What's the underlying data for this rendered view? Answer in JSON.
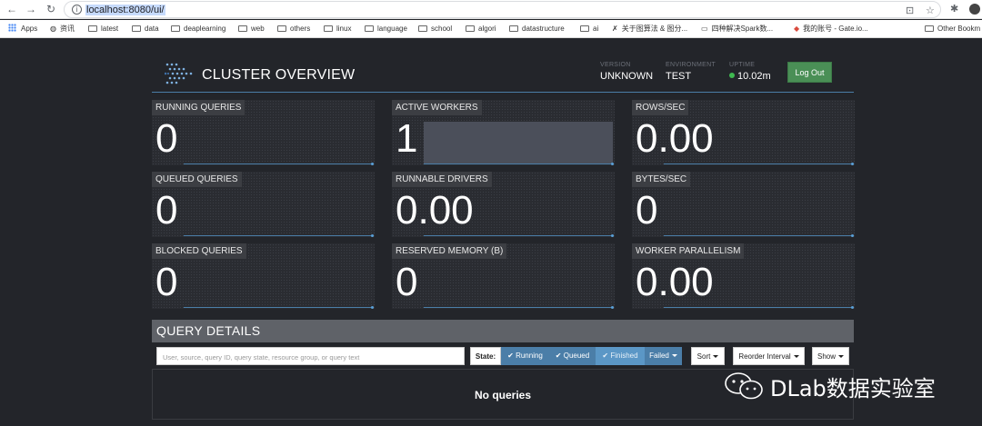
{
  "browser": {
    "url": "localhost:8080/ui/",
    "bookmarks": [
      {
        "label": "Apps",
        "type": "apps"
      },
      {
        "label": "资讯",
        "type": "globe"
      },
      {
        "label": "latest",
        "type": "folder"
      },
      {
        "label": "data",
        "type": "folder"
      },
      {
        "label": "deaplearning",
        "type": "folder"
      },
      {
        "label": "web",
        "type": "folder"
      },
      {
        "label": "others",
        "type": "folder"
      },
      {
        "label": "linux",
        "type": "folder"
      },
      {
        "label": "language",
        "type": "folder"
      },
      {
        "label": "school",
        "type": "folder"
      },
      {
        "label": "algori",
        "type": "folder"
      },
      {
        "label": "datastructure",
        "type": "folder"
      },
      {
        "label": "ai",
        "type": "folder"
      },
      {
        "label": "关于图算法 & 图分...",
        "type": "page"
      },
      {
        "label": "四种解决Spark数...",
        "type": "page"
      },
      {
        "label": "我的账号 - Gate.io...",
        "type": "page"
      },
      {
        "label": "Other Bookm",
        "type": "folder"
      }
    ]
  },
  "header": {
    "title": "CLUSTER OVERVIEW",
    "version_label": "VERSION",
    "version_value": "UNKNOWN",
    "environment_label": "ENVIRONMENT",
    "environment_value": "TEST",
    "uptime_label": "UPTIME",
    "uptime_value": "10.02m",
    "logout_label": "Log Out"
  },
  "metrics": [
    {
      "label": "RUNNING QUERIES",
      "value": "0"
    },
    {
      "label": "ACTIVE WORKERS",
      "value": "1"
    },
    {
      "label": "ROWS/SEC",
      "value": "0.00"
    },
    {
      "label": "QUEUED QUERIES",
      "value": "0"
    },
    {
      "label": "RUNNABLE DRIVERS",
      "value": "0.00"
    },
    {
      "label": "BYTES/SEC",
      "value": "0"
    },
    {
      "label": "BLOCKED QUERIES",
      "value": "0"
    },
    {
      "label": "RESERVED MEMORY (B)",
      "value": "0"
    },
    {
      "label": "WORKER PARALLELISM",
      "value": "0.00"
    }
  ],
  "query_details": {
    "title": "QUERY DETAILS",
    "search_placeholder": "User, source, query ID, query state, resource group, or query text",
    "state_label": "State:",
    "states": [
      {
        "label": "Running",
        "checked": true
      },
      {
        "label": "Queued",
        "checked": true
      },
      {
        "label": "Finished",
        "checked": true
      },
      {
        "label": "Failed",
        "checked": false
      }
    ],
    "sort_label": "Sort",
    "reorder_label": "Reorder Interval",
    "show_label": "Show",
    "empty_message": "No queries"
  },
  "watermark": {
    "text": "DLab数据实验室"
  }
}
